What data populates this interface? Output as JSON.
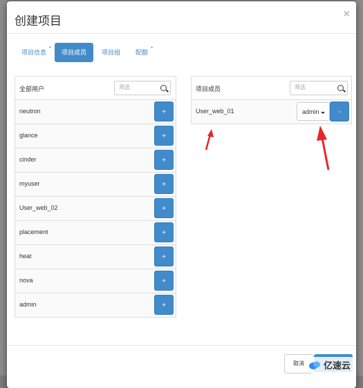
{
  "modal": {
    "title": "创建项目",
    "close_glyph": "×"
  },
  "tabs": [
    {
      "label": "项目信息",
      "required_mark": "*"
    },
    {
      "label": "项目成员",
      "active": true
    },
    {
      "label": "项目组"
    },
    {
      "label": "配额",
      "required_mark": "*"
    }
  ],
  "all_users": {
    "title": "全部用户",
    "filter_placeholder": "筛选",
    "add_glyph": "+",
    "users": [
      "neutron",
      "glance",
      "cinder",
      "myuser",
      "User_web_02",
      "placement",
      "heat",
      "nova",
      "admin"
    ]
  },
  "members": {
    "title": "项目成员",
    "filter_placeholder": "筛选",
    "remove_glyph": "-",
    "rows": [
      {
        "name": "User_web_01",
        "role": "admin"
      }
    ]
  },
  "footer": {
    "cancel_label": "取消"
  },
  "annotations": {
    "arrow_color": "#e8262a"
  },
  "watermark": {
    "text": "亿速云"
  },
  "colors": {
    "primary": "#428bca"
  }
}
